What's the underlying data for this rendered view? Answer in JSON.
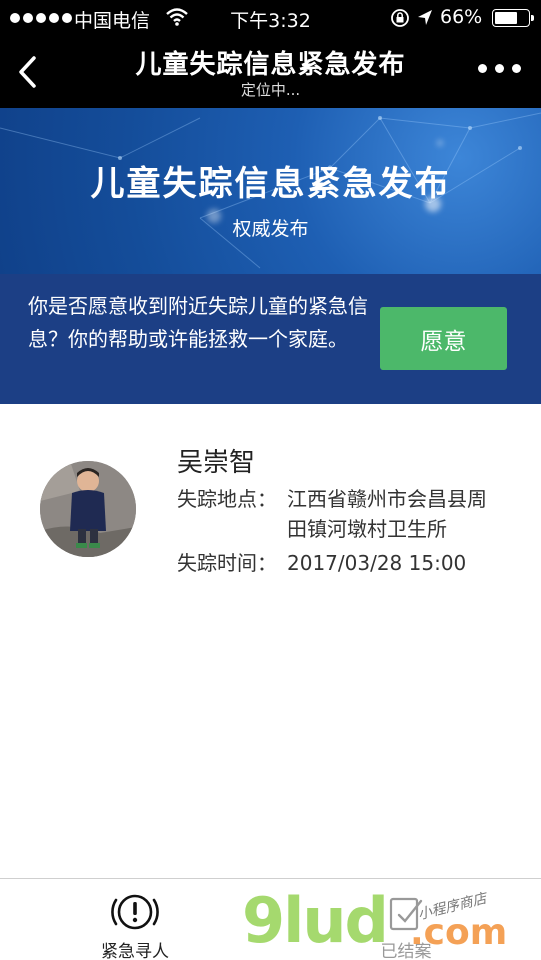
{
  "status_bar": {
    "carrier": "中国电信",
    "time": "下午3:32",
    "battery": "66%"
  },
  "nav": {
    "title": "儿童失踪信息紧急发布",
    "subtitle": "定位中..."
  },
  "banner": {
    "title": "儿童失踪信息紧急发布",
    "subtitle": "权威发布"
  },
  "prompt": {
    "text": "你是否愿意收到附近失踪儿童的紧急信息？你的帮助或许能拯救一个家庭。",
    "button": "愿意"
  },
  "child": {
    "name": "吴崇智",
    "location_label": "失踪地点：",
    "location": "江西省赣州市会昌县周田镇河墩村卫生所",
    "time_label": "失踪时间：",
    "time": "2017/03/28 15:00"
  },
  "tabs": [
    {
      "label": "紧急寻人",
      "icon": "alert-circle-icon"
    },
    {
      "label": "已结案",
      "icon": "closed-case-icon"
    }
  ],
  "watermark": {
    "main": "9lud",
    "suffix": ".com",
    "handwritten": "小程序商店"
  },
  "colors": {
    "prompt_bg": "#1c3f85",
    "agree_button": "#4cb86a",
    "banner_blue": "#1e5fb3"
  }
}
